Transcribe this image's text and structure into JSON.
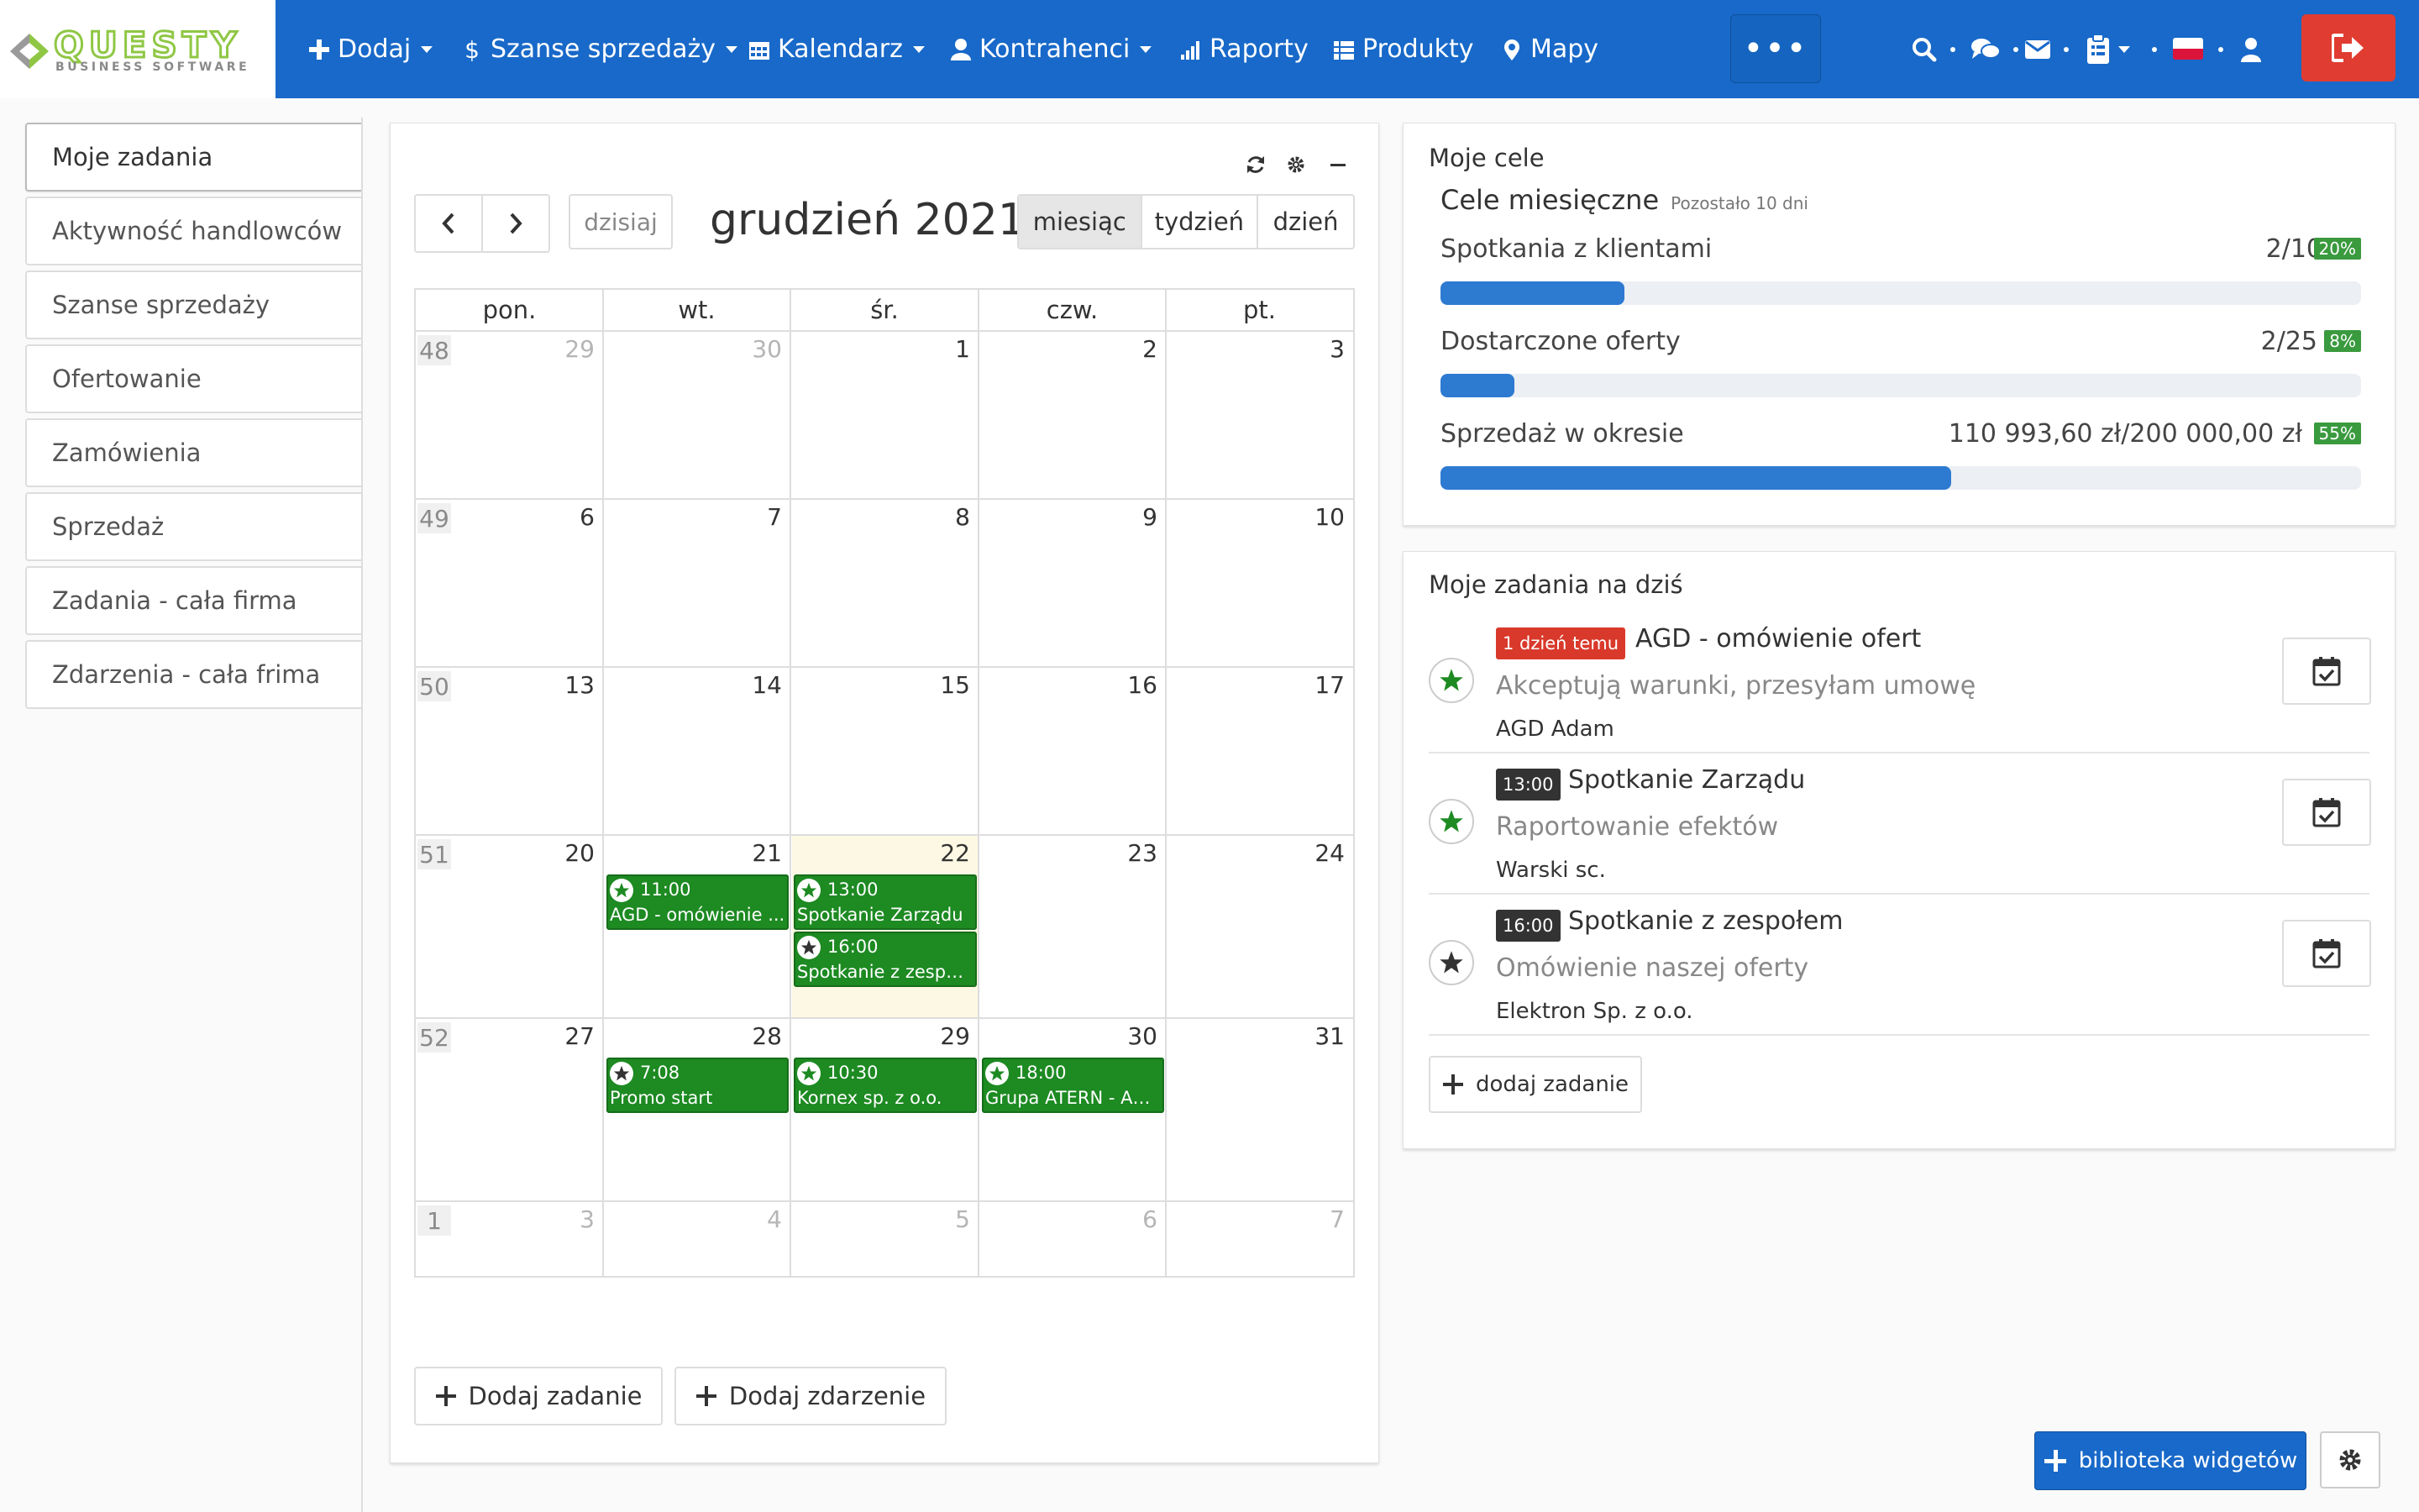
{
  "brand": {
    "name": "QUESTY",
    "tagline": "BUSINESS SOFTWARE"
  },
  "nav": [
    {
      "label": "Dodaj",
      "icon": "plus-icon",
      "dropdown": true
    },
    {
      "label": "Szanse sprzedaży",
      "icon": "dollar-icon",
      "dropdown": true
    },
    {
      "label": "Kalendarz",
      "icon": "calendar-icon",
      "dropdown": true
    },
    {
      "label": "Kontrahenci",
      "icon": "user-icon",
      "dropdown": true
    },
    {
      "label": "Raporty",
      "icon": "bar-chart-icon",
      "dropdown": false
    },
    {
      "label": "Produkty",
      "icon": "list-icon",
      "dropdown": false
    },
    {
      "label": "Mapy",
      "icon": "map-marker-icon",
      "dropdown": false
    }
  ],
  "more_label": "•••",
  "sidebar": {
    "items": [
      {
        "label": "Moje zadania",
        "active": true
      },
      {
        "label": "Aktywność handlowców"
      },
      {
        "label": "Szanse sprzedaży"
      },
      {
        "label": "Ofertowanie"
      },
      {
        "label": "Zamówienia"
      },
      {
        "label": "Sprzedaż"
      },
      {
        "label": "Zadania - cała firma"
      },
      {
        "label": "Zdarzenia - cała frima"
      }
    ]
  },
  "calendar": {
    "today_label": "dzisiaj",
    "title": "grudzień 2021",
    "views": [
      "miesiąc",
      "tydzień",
      "dzień"
    ],
    "active_view": "miesiąc",
    "weekdays": [
      "pon.",
      "wt.",
      "śr.",
      "czw.",
      "pt."
    ],
    "weeks": [
      {
        "num": "48",
        "days": [
          {
            "d": "29",
            "other": true
          },
          {
            "d": "30",
            "other": true
          },
          {
            "d": "1"
          },
          {
            "d": "2"
          },
          {
            "d": "3"
          }
        ]
      },
      {
        "num": "49",
        "days": [
          {
            "d": "6"
          },
          {
            "d": "7"
          },
          {
            "d": "8"
          },
          {
            "d": "9"
          },
          {
            "d": "10"
          }
        ]
      },
      {
        "num": "50",
        "days": [
          {
            "d": "13"
          },
          {
            "d": "14"
          },
          {
            "d": "15"
          },
          {
            "d": "16"
          },
          {
            "d": "17"
          }
        ]
      },
      {
        "num": "51",
        "days": [
          {
            "d": "20"
          },
          {
            "d": "21"
          },
          {
            "d": "22",
            "today": true
          },
          {
            "d": "23"
          },
          {
            "d": "24"
          }
        ]
      },
      {
        "num": "52",
        "days": [
          {
            "d": "27"
          },
          {
            "d": "28"
          },
          {
            "d": "29"
          },
          {
            "d": "30"
          },
          {
            "d": "31"
          }
        ]
      },
      {
        "num": "1",
        "days": [
          {
            "d": "3",
            "other": true
          },
          {
            "d": "4",
            "other": true
          },
          {
            "d": "5",
            "other": true
          },
          {
            "d": "6",
            "other": true
          },
          {
            "d": "7",
            "other": true
          }
        ]
      }
    ],
    "events": [
      {
        "week": 3,
        "day": 1,
        "slot": 0,
        "time": "11:00",
        "title": "AGD - omówienie ...",
        "star": "green"
      },
      {
        "week": 3,
        "day": 2,
        "slot": 0,
        "time": "13:00",
        "title": "Spotkanie Zarządu",
        "star": "green"
      },
      {
        "week": 3,
        "day": 2,
        "slot": 1,
        "time": "16:00",
        "title": "Spotkanie z zespoł...",
        "star": "dark"
      },
      {
        "week": 4,
        "day": 1,
        "slot": 0,
        "time": "7:08",
        "title": "Promo start",
        "star": "dark"
      },
      {
        "week": 4,
        "day": 2,
        "slot": 0,
        "time": "10:30",
        "title": "Kornex sp. z o.o.",
        "star": "green"
      },
      {
        "week": 4,
        "day": 3,
        "slot": 0,
        "time": "18:00",
        "title": "Grupa ATERN - Aud...",
        "star": "green"
      }
    ],
    "add_task_label": "Dodaj zadanie",
    "add_event_label": "Dodaj zdarzenie"
  },
  "goals": {
    "panel_title": "Moje cele",
    "section_title": "Cele miesięczne",
    "remaining": "Pozostało 10 dni",
    "items": [
      {
        "label": "Spotkania z klientami",
        "value": "2/10",
        "pct_label": "20%",
        "fraction": 0.2
      },
      {
        "label": "Dostarczone oferty",
        "value": "2/25",
        "pct_label": "8%",
        "fraction": 0.08
      },
      {
        "label": "Sprzedaż w okresie",
        "value": "110 993,60 zł/200 000,00 zł",
        "pct_label": "55%",
        "fraction": 0.555
      }
    ]
  },
  "tasks": {
    "panel_title": "Moje zadania na dziś",
    "items": [
      {
        "badge": "1 dzień temu",
        "badge_color": "#d9392b",
        "title": "AGD - omówienie ofert",
        "desc": "Akceptują warunki, przesyłam umowę",
        "client": "AGD Adam",
        "star": "green"
      },
      {
        "badge": "13:00",
        "badge_color": "#333333",
        "title": "Spotkanie Zarządu",
        "desc": "Raportowanie efektów",
        "client": "Warski sc.",
        "star": "green"
      },
      {
        "badge": "16:00",
        "badge_color": "#333333",
        "title": "Spotkanie z zespołem",
        "desc": "Omówienie naszej oferty",
        "client": "Elektron Sp. z o.o.",
        "star": "dark"
      }
    ],
    "add_label": "dodaj zadanie"
  },
  "widget_library_label": "biblioteka widgetów",
  "colors": {
    "nav": "#1869c9",
    "event": "#1d8a22",
    "logout": "#e03c31",
    "progress": "#2d7ad1"
  }
}
